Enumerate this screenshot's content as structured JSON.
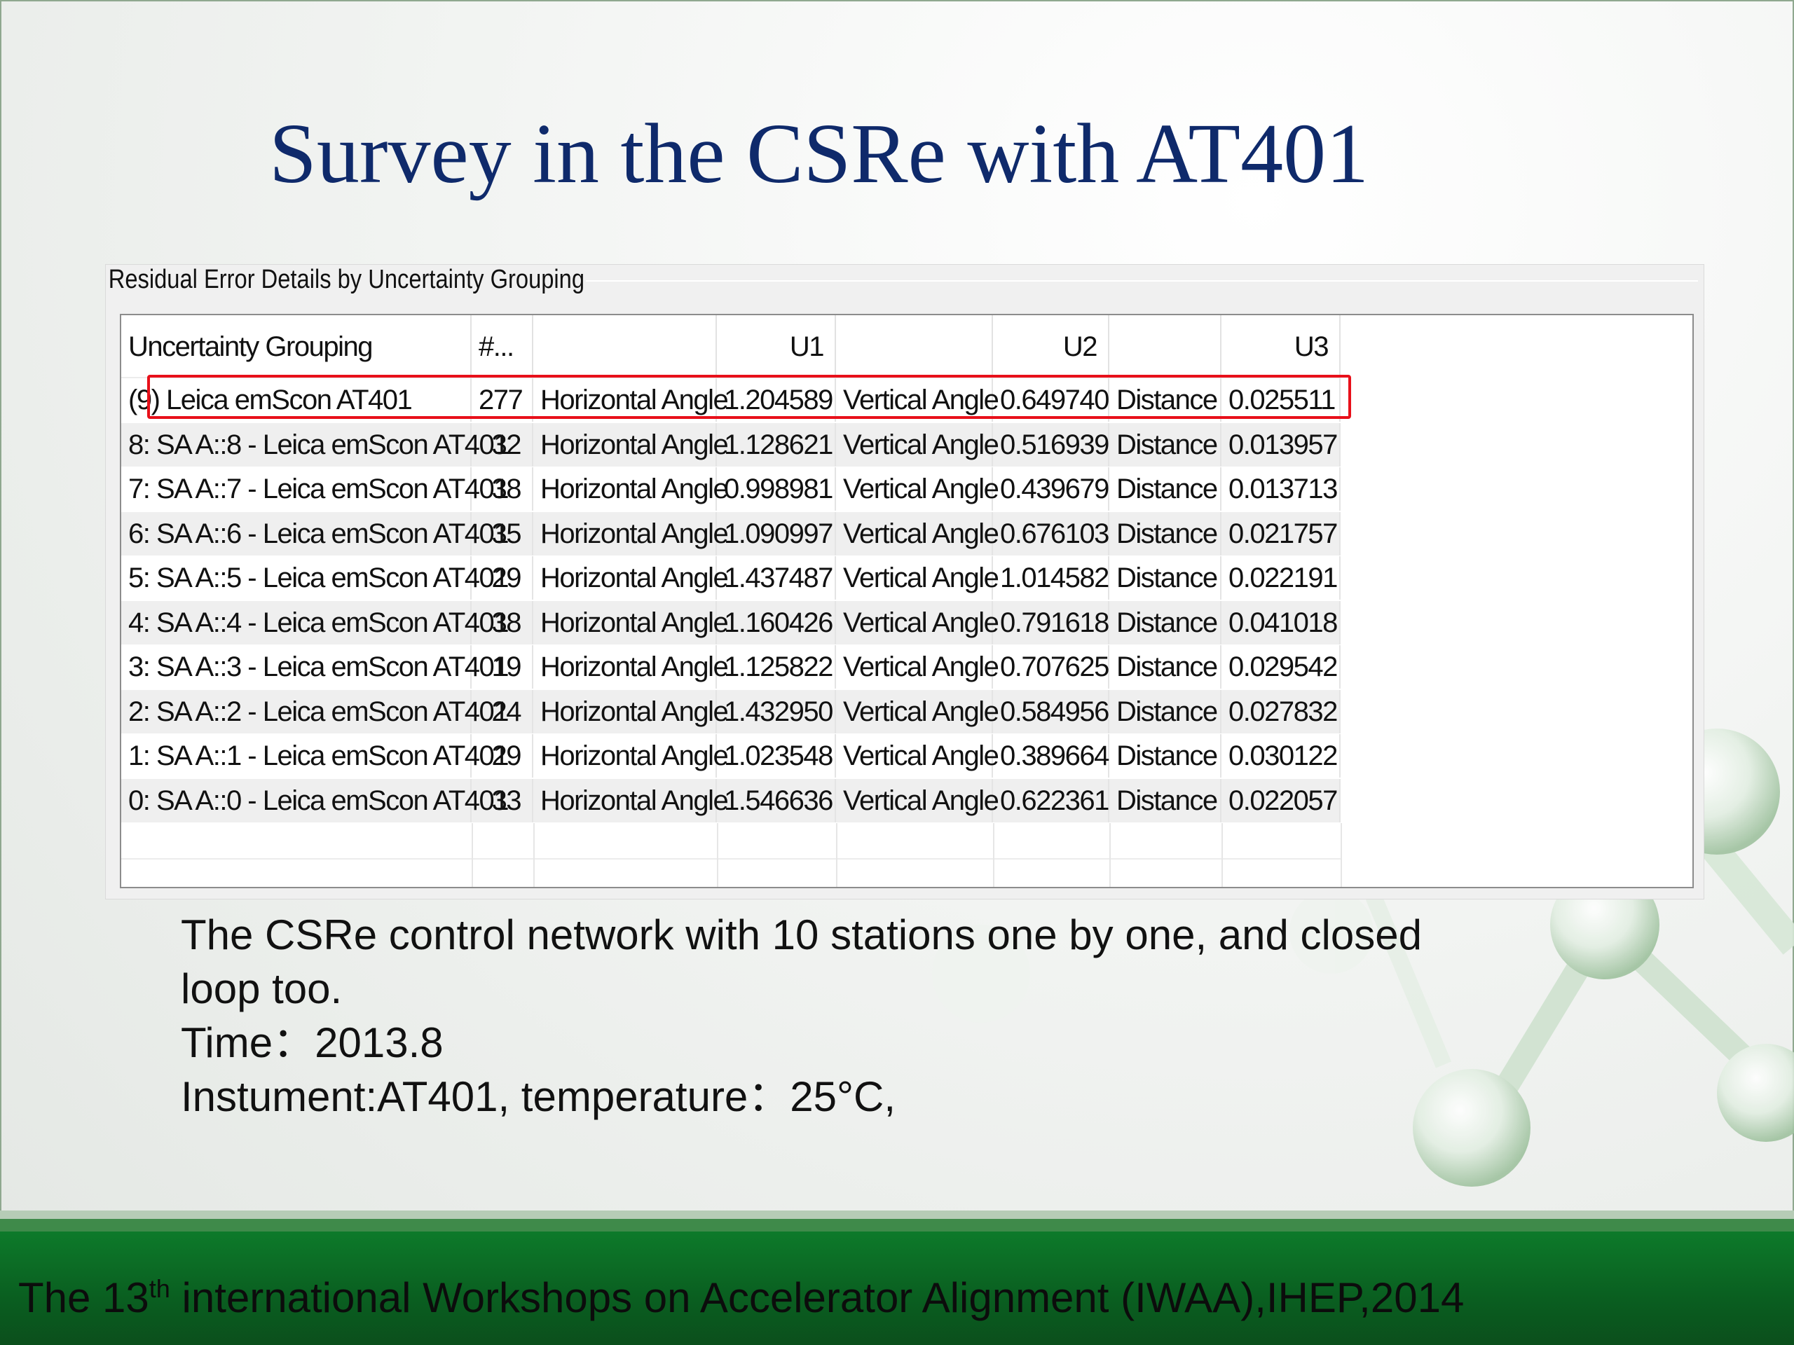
{
  "slide": {
    "title": "Survey in the CSRe with AT401"
  },
  "panel": {
    "title": "Residual Error Details by Uncertainty Grouping",
    "columns": [
      "Uncertainty Grouping",
      "#...",
      "",
      "U1",
      "",
      "U2",
      "",
      "U3"
    ],
    "rows": [
      [
        "(9) Leica emScon AT401",
        "277",
        "Horizontal Angle",
        "1.204589",
        "Vertical Angle",
        "0.649740",
        "Distance",
        "0.025511"
      ],
      [
        "8: SA A::8 - Leica emScon AT401",
        "32",
        "Horizontal Angle",
        "1.128621",
        "Vertical Angle",
        "0.516939",
        "Distance",
        "0.013957"
      ],
      [
        "7: SA A::7 - Leica emScon AT401",
        "38",
        "Horizontal Angle",
        "0.998981",
        "Vertical Angle",
        "0.439679",
        "Distance",
        "0.013713"
      ],
      [
        "6: SA A::6 - Leica emScon AT401",
        "35",
        "Horizontal Angle",
        "1.090997",
        "Vertical Angle",
        "0.676103",
        "Distance",
        "0.021757"
      ],
      [
        "5: SA A::5 - Leica emScon AT401",
        "29",
        "Horizontal Angle",
        "1.437487",
        "Vertical Angle",
        "1.014582",
        "Distance",
        "0.022191"
      ],
      [
        "4: SA A::4 - Leica emScon AT401",
        "38",
        "Horizontal Angle",
        "1.160426",
        "Vertical Angle",
        "0.791618",
        "Distance",
        "0.041018"
      ],
      [
        "3: SA A::3 - Leica emScon AT401",
        "19",
        "Horizontal Angle",
        "1.125822",
        "Vertical Angle",
        "0.707625",
        "Distance",
        "0.029542"
      ],
      [
        "2: SA A::2 - Leica emScon AT401",
        "24",
        "Horizontal Angle",
        "1.432950",
        "Vertical Angle",
        "0.584956",
        "Distance",
        "0.027832"
      ],
      [
        "1: SA A::1 - Leica emScon AT401",
        "29",
        "Horizontal Angle",
        "1.023548",
        "Vertical Angle",
        "0.389664",
        "Distance",
        "0.030122"
      ],
      [
        "0: SA A::0 - Leica emScon AT401",
        "33",
        "Horizontal Angle",
        "1.546636",
        "Vertical Angle",
        "0.622361",
        "Distance",
        "0.022057"
      ]
    ],
    "highlight_color": "#e8101a"
  },
  "body": {
    "line1": "The CSRe control network with 10 stations one by one, and closed",
    "line2": "loop too.",
    "line3": "Time：2013.8",
    "line4": "Instument:AT401,  temperature：25°C,"
  },
  "footer": {
    "text_before": "The 13",
    "sup": "th",
    "text_after": " international Workshops on Accelerator Alignment (IWAA),IHEP,2014",
    "color": "#0d7a2a"
  }
}
